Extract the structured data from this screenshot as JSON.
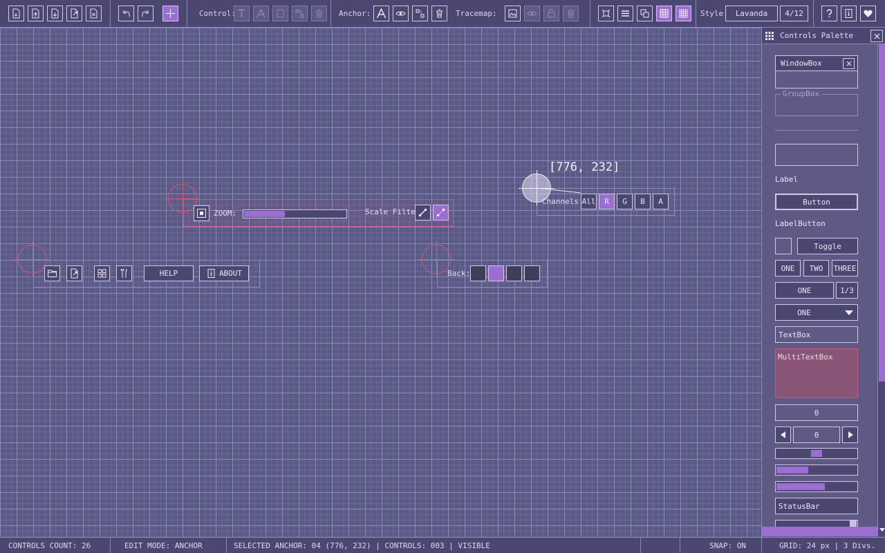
{
  "toolbar": {
    "control_label": "Control:",
    "anchor_label": "Anchor:",
    "tracemap_label": "Tracemap:",
    "style_label": "Style:",
    "style_value": "Lavanda",
    "style_index": "4/12"
  },
  "zoom_panel": {
    "zoom_label": "ZOOM:",
    "zoom_level": 0.4,
    "scale_filter_label": "Scale Filter:"
  },
  "channels_panel": {
    "coord_tooltip": "[776, 232]",
    "channels_label": "Channels:",
    "buttons": [
      "All",
      "R",
      "G",
      "B",
      "A"
    ],
    "selected": "R"
  },
  "left_panel": {
    "help_label": "HELP",
    "about_label": "ABOUT"
  },
  "back_panel": {
    "back_label": "Back:"
  },
  "palette": {
    "title": "Controls Palette",
    "window_box": "WindowBox",
    "group_box": "GroupBox",
    "label": "Label",
    "button": "Button",
    "label_button": "LabelButton",
    "toggle": "Toggle",
    "toggle_group": [
      "ONE",
      "TWO",
      "THREE"
    ],
    "combo_value": "ONE",
    "combo_count": "1/3",
    "dropdown_value": "ONE",
    "textbox": "TextBox",
    "multitextbox": "MultiTextBox",
    "value_box": "0",
    "spinner_value": "0",
    "slider_level": 0.5,
    "sliderbar_level": 0.4,
    "progress_level": 0.6,
    "statusbar": "StatusBar"
  },
  "statusbar": {
    "controls_count": "CONTROLS COUNT: 26",
    "edit_mode": "EDIT MODE: ANCHOR",
    "selected": "SELECTED ANCHOR: 04  (776, 232) | CONTROLS: 003 | VISIBLE",
    "snap": "SNAP: ON",
    "grid": "GRID: 24 px | 3 Divs."
  },
  "colors": {
    "background": "#5d5b86",
    "panel": "#4a4870",
    "accent": "#9a6fcf",
    "anchor": "#d2567a",
    "border": "#cfcbe8"
  }
}
